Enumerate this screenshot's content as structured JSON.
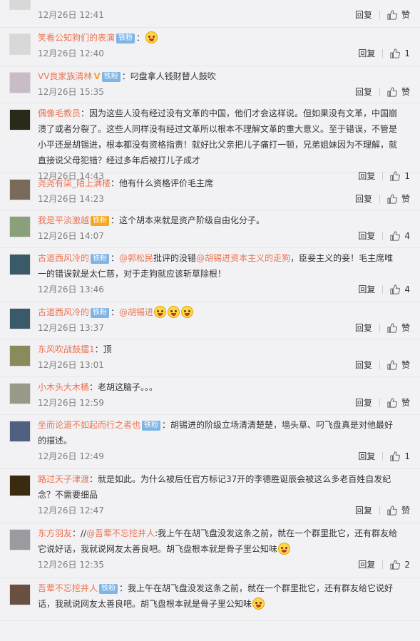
{
  "labels": {
    "reply": "回复",
    "like_zero": "赞"
  },
  "partial_top": {
    "time": "12月26日 12:41",
    "likes": "赞"
  },
  "comments": [
    {
      "user": "笑看公知狗们的表演",
      "badge": "铁粉",
      "text_before": "：",
      "mentions": [],
      "text": "",
      "emojis": 1,
      "time": "12月26日 12:40",
      "likes": "1"
    },
    {
      "user": "VV良家族清林",
      "vip": true,
      "badge": "铁粉",
      "text_before": "：",
      "mentions": [],
      "text": "叼盘拿人钱财替人鼓吹",
      "emojis": 0,
      "time": "12月26日 15:35",
      "likes": "赞"
    },
    {
      "user": "偶像毛教员",
      "badge": "",
      "text_before": "：",
      "mentions": [],
      "text": "因为这些人没有经过没有文革的中国，他们才会这样说。但如果没有文革，中国崩溃了或者分裂了。这些人同样没有经过文革所以根本不理解文革的重大意义。至于错误，不管是小平还是胡锡进，根本都没有资格指责！就好比父亲把儿子痛打一顿，兄弟姐妹因为不理解，就直接说父母犯错？经过多年后被打儿子成才",
      "emojis": 0,
      "time": "12月26日 14:43",
      "likes": "1"
    },
    {
      "user": "尧尧有柒_陌上满楼",
      "badge": "",
      "text_before": "：",
      "mentions": [],
      "text": "他有什么资格评价毛主席",
      "emojis": 0,
      "time": "12月26日 14:23",
      "likes": "赞"
    },
    {
      "user": "我是平淡激越",
      "badge": "铁粉",
      "badge_style": "orange",
      "text_before": "：",
      "mentions": [],
      "text": "这个胡本来就是资产阶级自由化分子。",
      "emojis": 0,
      "time": "12月26日 14:07",
      "likes": "4"
    },
    {
      "user": "古道西风冷的",
      "badge": "铁粉",
      "text_before": "：",
      "mentions": [
        "@郭松民",
        "@胡锡进资本主义的走狗"
      ],
      "segments": [
        "批评的没错",
        "，臣妾主义的妾！毛主席唯一的错误就是太仁慈，对于走狗就应该斩草除根！"
      ],
      "emojis": 0,
      "time": "12月26日 13:46",
      "likes": "4"
    },
    {
      "user": "古道西风冷的",
      "badge": "铁粉",
      "text_before": "：",
      "mentions": [
        "@胡锡进"
      ],
      "text": "",
      "emojis": 3,
      "time": "12月26日 13:37",
      "likes": "赞"
    },
    {
      "user": "东风吹战鼓擂1",
      "badge": "",
      "text_before": "：",
      "mentions": [],
      "text": "顶",
      "emojis": 0,
      "time": "12月26日 13:01",
      "likes": "赞"
    },
    {
      "user": "小木头大木桶",
      "badge": "",
      "text_before": "：",
      "mentions": [],
      "text": "老胡这脑子。。。",
      "emojis": 0,
      "time": "12月26日 12:59",
      "likes": "赞"
    },
    {
      "user": "坐而论道不如起而行之者也",
      "badge": "铁粉",
      "text_before": "：",
      "mentions": [],
      "text": "胡锡进的阶级立场清清楚楚，墙头草、叼飞盘真是对他最好的描述。",
      "emojis": 0,
      "time": "12月26日 12:49",
      "likes": "1"
    },
    {
      "user": "路过天子津渡",
      "badge": "",
      "text_before": "：",
      "mentions": [],
      "text": "就是如此。为什么被后任官方标记37开的李德胜诞辰会被这么多老百姓自发纪念？不需要细品",
      "emojis": 0,
      "time": "12月26日 12:47",
      "likes": "赞"
    },
    {
      "user": "东方羽友",
      "badge": "",
      "text_before": "：//",
      "mentions": [
        "@吾辈不忘挖井人"
      ],
      "text": ":我上午在胡飞盘没发这条之前，就在一个群里批它，还有群友给它说好话，我就说网友太善良吧。胡飞盘根本就是骨子里公知味",
      "emojis": 1,
      "time": "12月26日 12:35",
      "likes": "2"
    },
    {
      "user": "吾辈不忘挖井人",
      "badge": "铁粉",
      "text_before": "：",
      "mentions": [],
      "text": "我上午在胡飞盘没发这条之前，就在一个群里批它，还有群友给它说好话，我就说网友太善良吧。胡飞盘根本就是骨子里公知味",
      "emojis": 1,
      "time": "",
      "likes": ""
    }
  ],
  "avatar_colors": [
    "#d8d8d8",
    "#d8d8d8",
    "#c9bcc8",
    "#2a2a1a",
    "#7a6a5a",
    "#8aa07a",
    "#3a5a6a",
    "#3a5a6a",
    "#8a8a5a",
    "#9a9a8a",
    "#506080",
    "#3a2a10",
    "#9a9aa0",
    "#6a5040"
  ]
}
